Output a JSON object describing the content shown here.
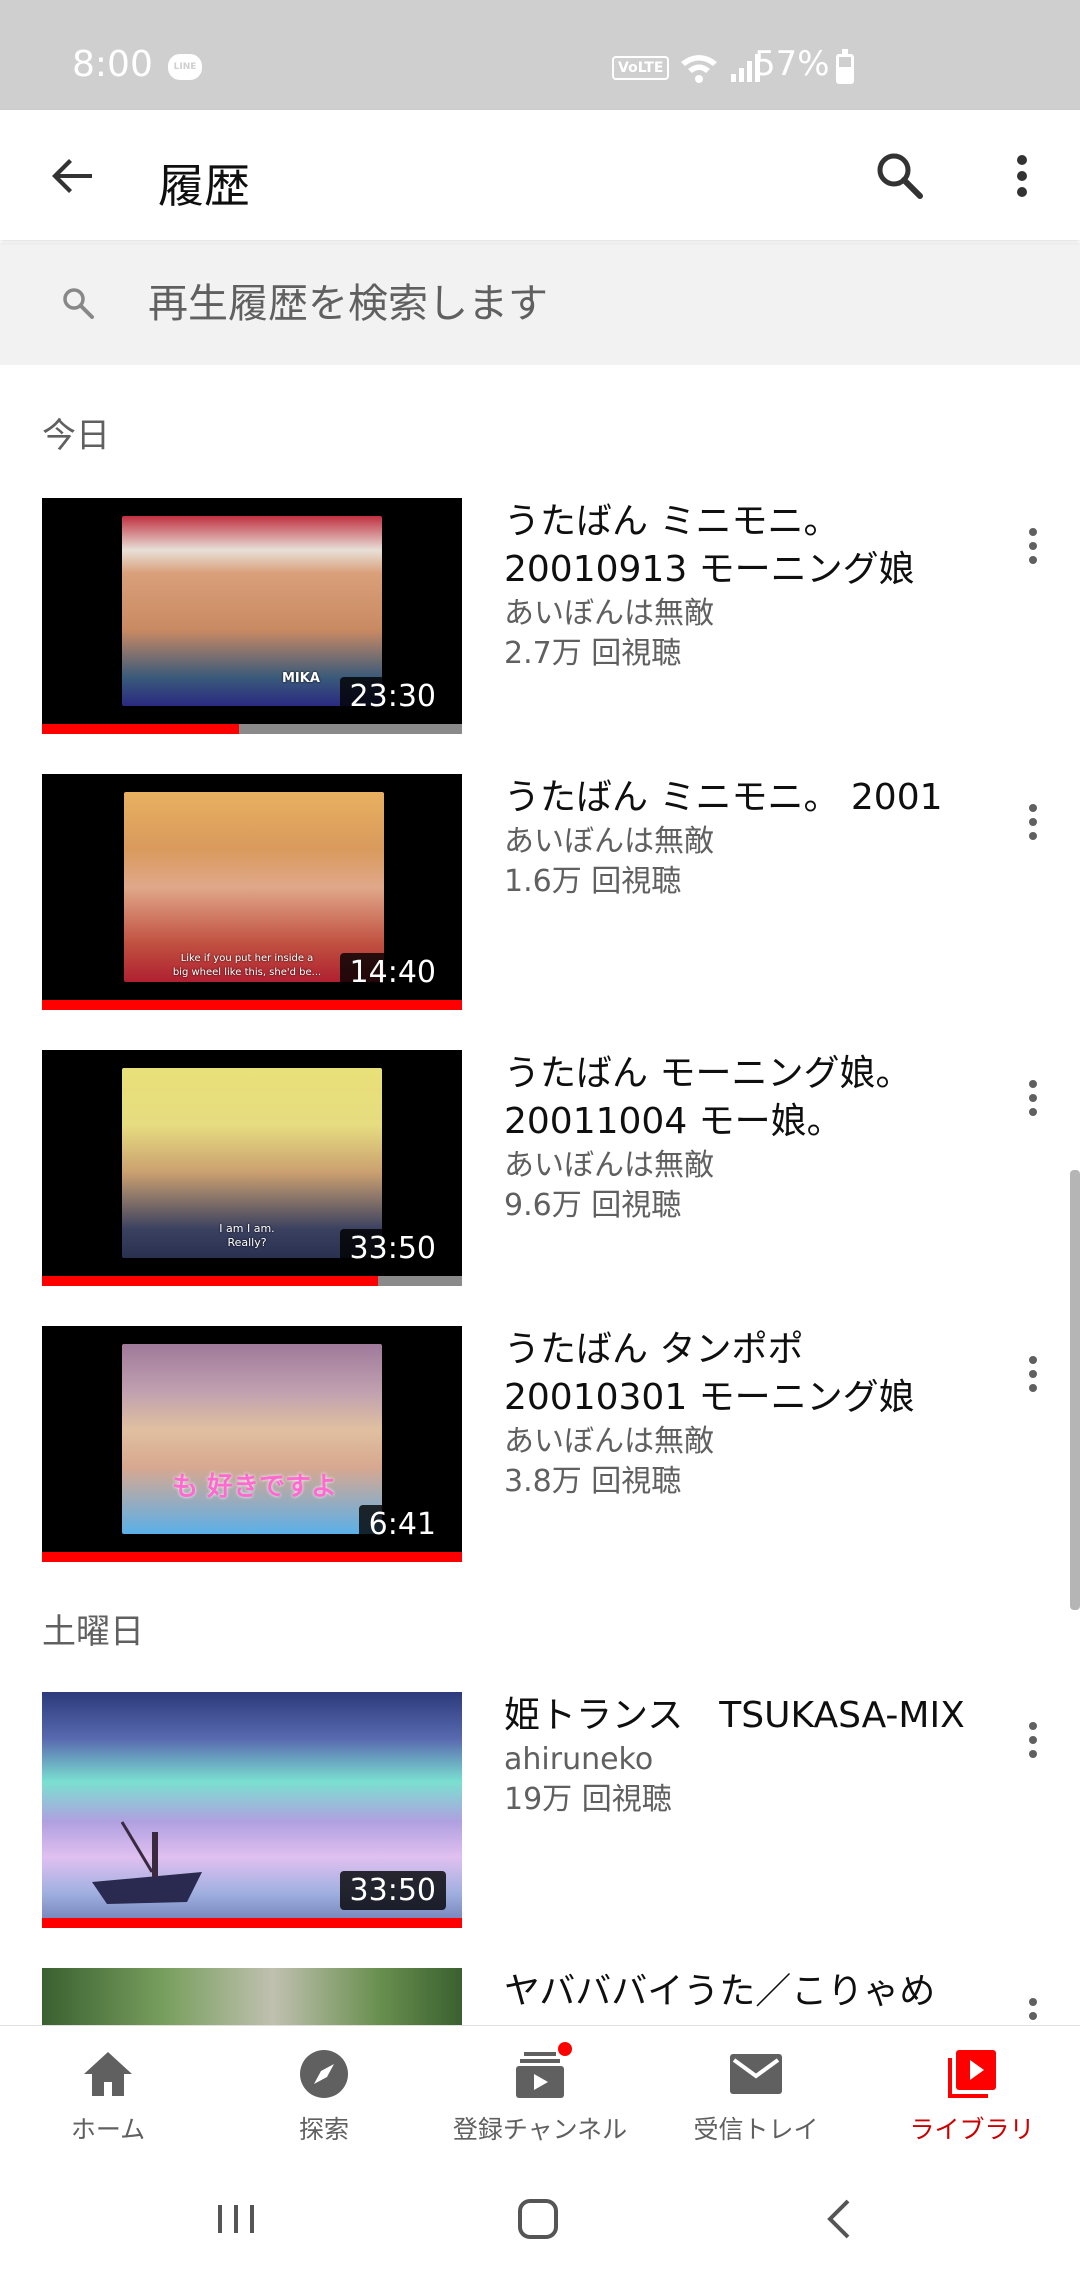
{
  "status_bar": {
    "time": "8:00",
    "line_icon": "LINE",
    "volte": "VoLTE",
    "battery": "57%"
  },
  "app_bar": {
    "title": "履歴"
  },
  "history_search": {
    "placeholder": "再生履歴を検索します"
  },
  "sections": [
    {
      "header": "今日",
      "videos": [
        {
          "title": "うたばん ミニモニ。 20010913 モーニング娘",
          "channel": "あいぼんは無敵",
          "views": "2.7万 回視聴",
          "duration": "23:30",
          "progress": 0.47,
          "thumb_caption": "MIKA"
        },
        {
          "title": "うたばん ミニモニ。 2001",
          "channel": "あいぼんは無敵",
          "views": "1.6万 回視聴",
          "duration": "14:40",
          "progress": 1.0,
          "thumb_caption": "Like if you put her inside a big wheel like this, she'd be..."
        },
        {
          "title": "うたばん モーニング娘。 20011004 モー娘。",
          "channel": "あいぼんは無敵",
          "views": "9.6万 回視聴",
          "duration": "33:50",
          "progress": 0.8,
          "thumb_caption": "I am I am. Really?"
        },
        {
          "title": "うたばん タンポポ 20010301 モーニング娘",
          "channel": "あいぼんは無敵",
          "views": "3.8万 回視聴",
          "duration": "6:41",
          "progress": 1.0,
          "thumb_caption": "も 好きですよ"
        }
      ]
    },
    {
      "header": "土曜日",
      "videos": [
        {
          "title": "姫トランス　TSUKASA-MIX",
          "channel": "ahiruneko",
          "views": "19万 回視聴",
          "duration": "33:50",
          "progress": 1.0
        },
        {
          "title": "ヤバババイうた／こりゃめ",
          "channel": "",
          "views": "",
          "duration": "",
          "progress": 0
        }
      ]
    }
  ],
  "bottom_nav": [
    {
      "label": "ホーム",
      "icon": "home-icon"
    },
    {
      "label": "探索",
      "icon": "explore-icon"
    },
    {
      "label": "登録チャンネル",
      "icon": "subscriptions-icon"
    },
    {
      "label": "受信トレイ",
      "icon": "inbox-icon"
    },
    {
      "label": "ライブラリ",
      "icon": "library-icon"
    }
  ],
  "colors": {
    "accent": "#ff0000",
    "active_label": "#cc0000",
    "secondary_text": "#606060",
    "status_bar": "#cfcfcf"
  }
}
